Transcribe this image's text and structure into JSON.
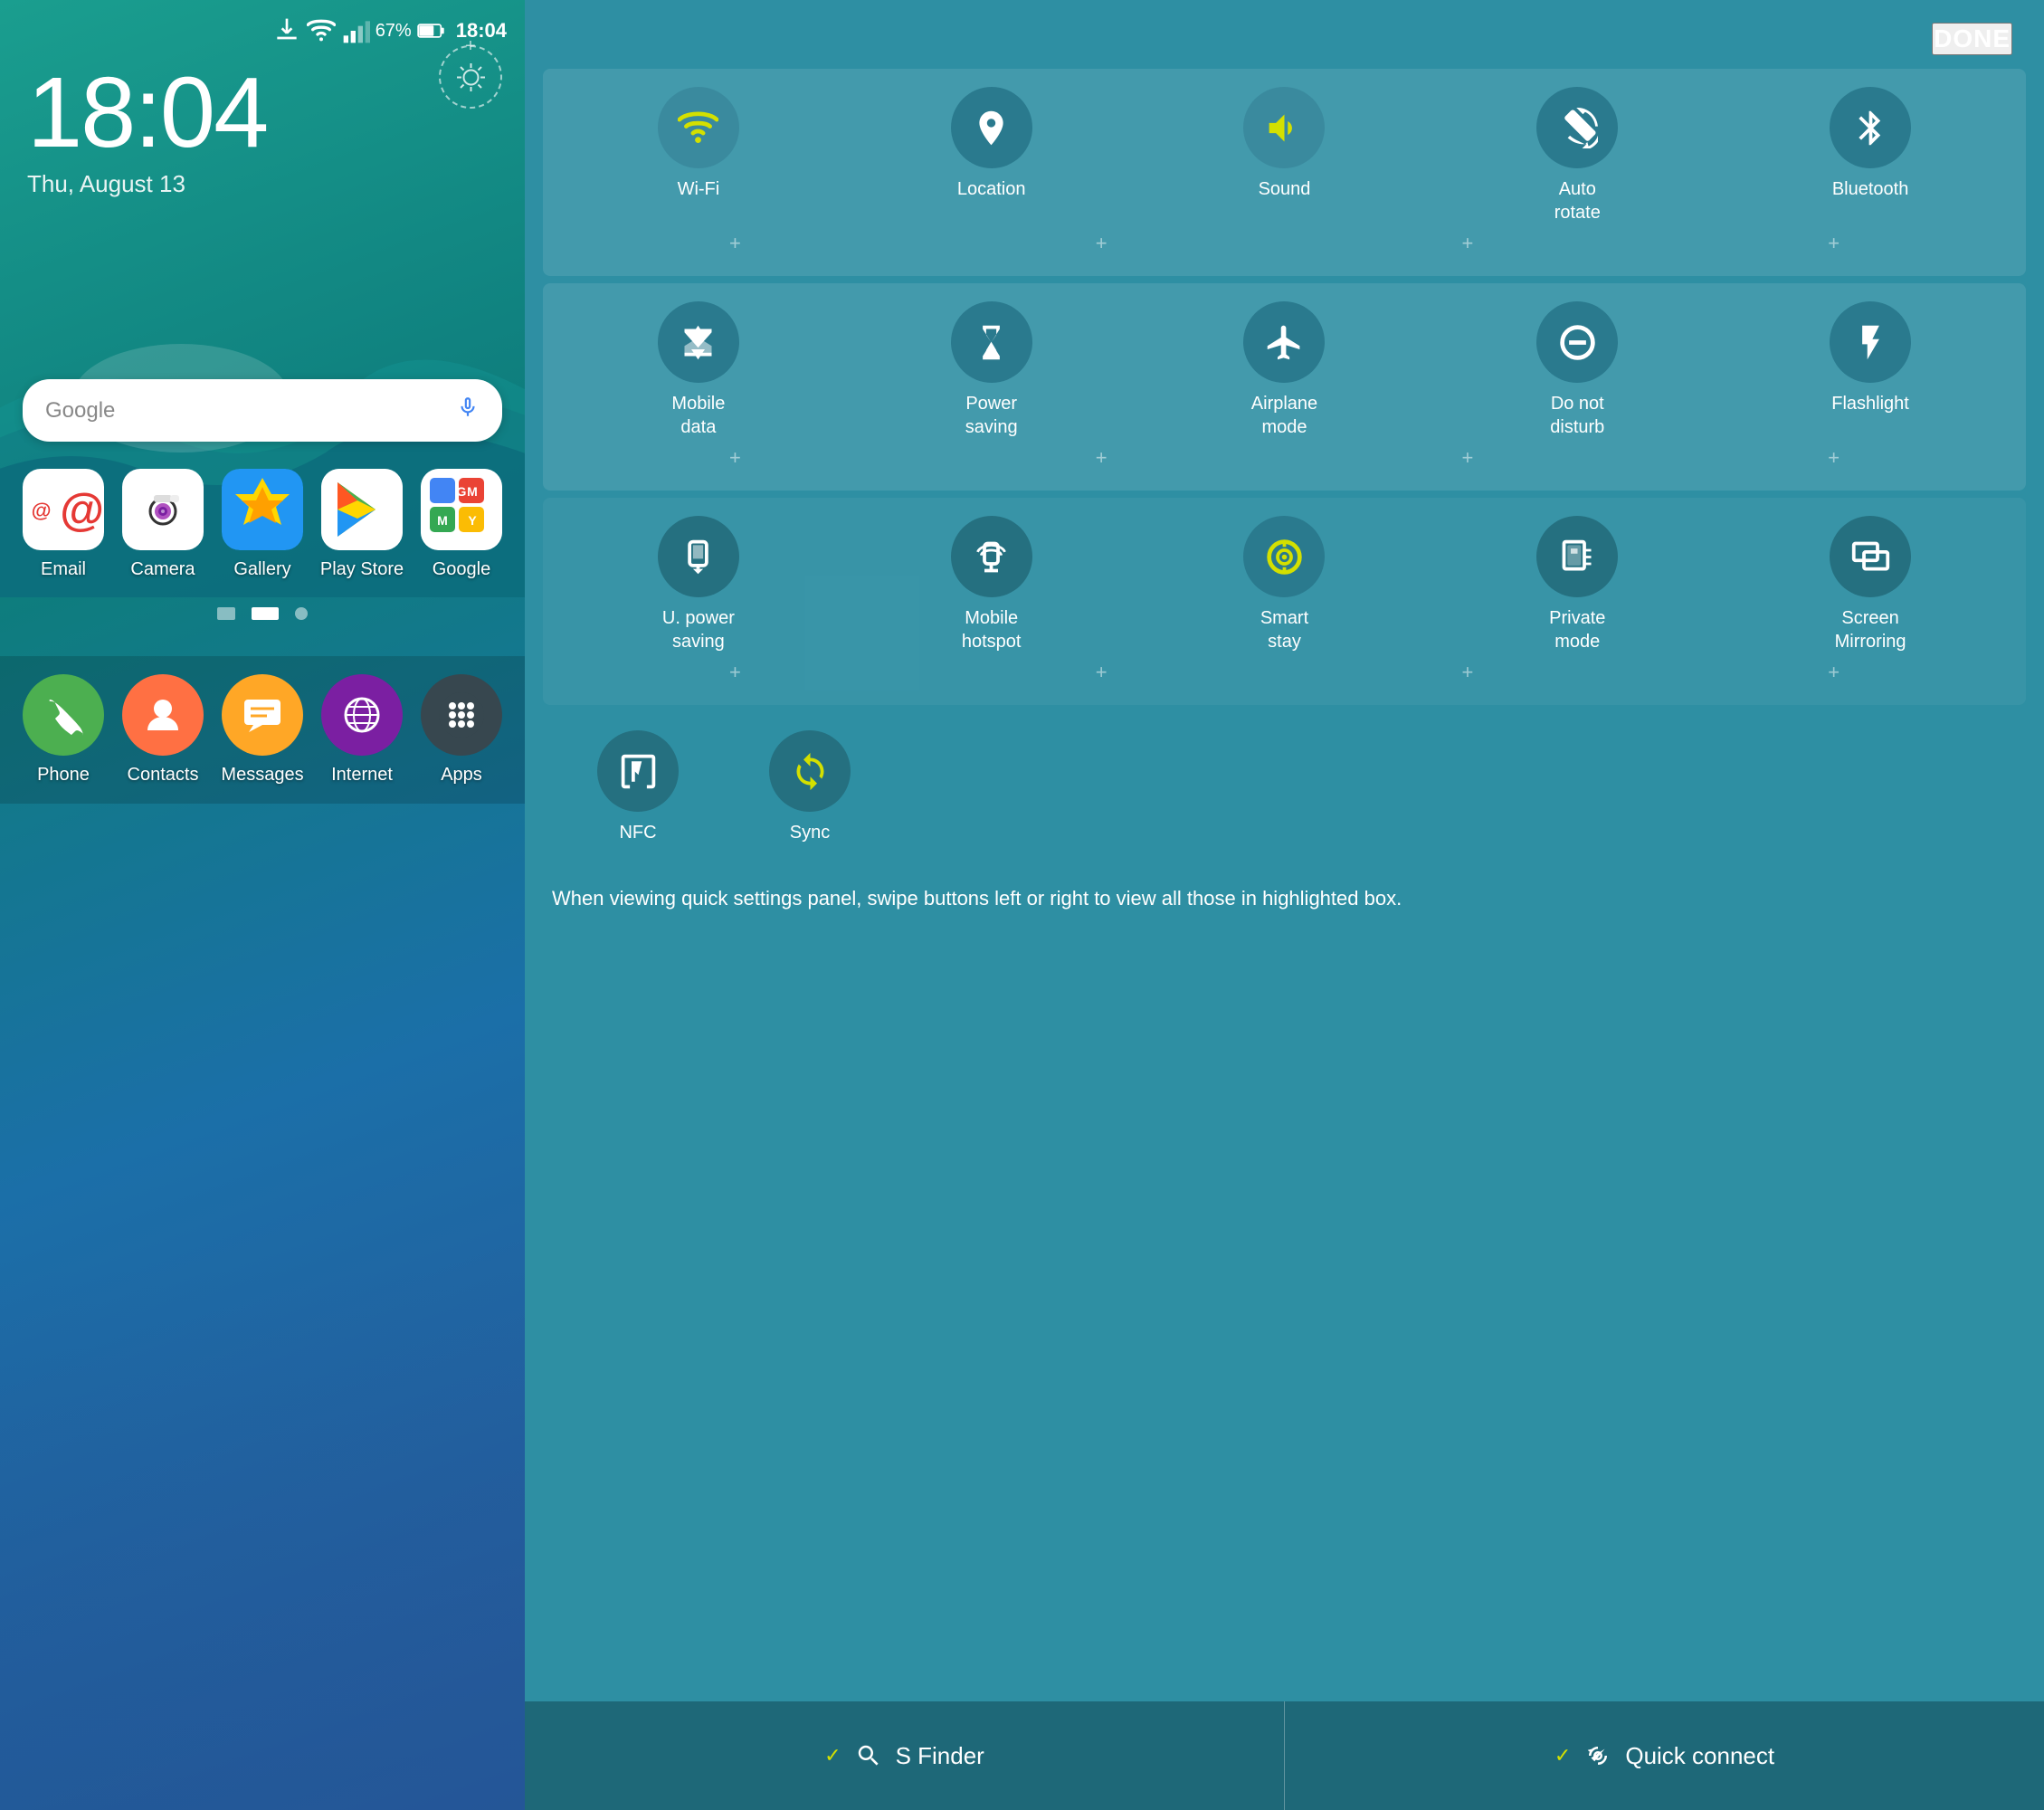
{
  "left": {
    "status": {
      "battery": "67%",
      "time": "18:04"
    },
    "clock": {
      "time": "18:04",
      "date": "Thu, August 13"
    },
    "search": {
      "placeholder": "Google",
      "mic_label": "voice search"
    },
    "apps": [
      {
        "id": "email",
        "label": "Email"
      },
      {
        "id": "camera",
        "label": "Camera"
      },
      {
        "id": "gallery",
        "label": "Gallery"
      },
      {
        "id": "playstore",
        "label": "Play Store"
      },
      {
        "id": "google",
        "label": "Google"
      }
    ],
    "dock": [
      {
        "id": "phone",
        "label": "Phone"
      },
      {
        "id": "contacts",
        "label": "Contacts"
      },
      {
        "id": "messages",
        "label": "Messages"
      },
      {
        "id": "internet",
        "label": "Internet"
      },
      {
        "id": "apps",
        "label": "Apps"
      }
    ]
  },
  "right": {
    "done_label": "DONE",
    "row1": [
      {
        "id": "wifi",
        "label": "Wi-Fi",
        "active": true
      },
      {
        "id": "location",
        "label": "Location",
        "active": false
      },
      {
        "id": "sound",
        "label": "Sound",
        "active": true
      },
      {
        "id": "autorotate",
        "label": "Auto\nrotate",
        "active": false
      },
      {
        "id": "bluetooth",
        "label": "Bluetooth",
        "active": false
      }
    ],
    "row2": [
      {
        "id": "mobiledata",
        "label": "Mobile\ndata",
        "active": false
      },
      {
        "id": "powersaving",
        "label": "Power\nsaving",
        "active": false
      },
      {
        "id": "airplanemode",
        "label": "Airplane\nmode",
        "active": false
      },
      {
        "id": "donotdisturb",
        "label": "Do not\ndisturb",
        "active": false
      },
      {
        "id": "flashlight",
        "label": "Flashlight",
        "active": false
      }
    ],
    "row3": [
      {
        "id": "upowersaving",
        "label": "U. power\nsaving",
        "active": false
      },
      {
        "id": "mobilehotspot",
        "label": "Mobile\nhotspot",
        "active": false
      },
      {
        "id": "smartstay",
        "label": "Smart\nstay",
        "active": true
      },
      {
        "id": "privatemode",
        "label": "Private\nmode",
        "active": false
      },
      {
        "id": "screenmirroring",
        "label": "Screen\nMirroring",
        "active": false
      }
    ],
    "row4": [
      {
        "id": "nfc",
        "label": "NFC",
        "active": false
      },
      {
        "id": "sync",
        "label": "Sync",
        "active": true
      }
    ],
    "help_text": "When viewing quick settings panel, swipe buttons left or right to view all those in highlighted box.",
    "bottom": {
      "sfinder_label": "S Finder",
      "quickconnect_label": "Quick connect"
    }
  }
}
